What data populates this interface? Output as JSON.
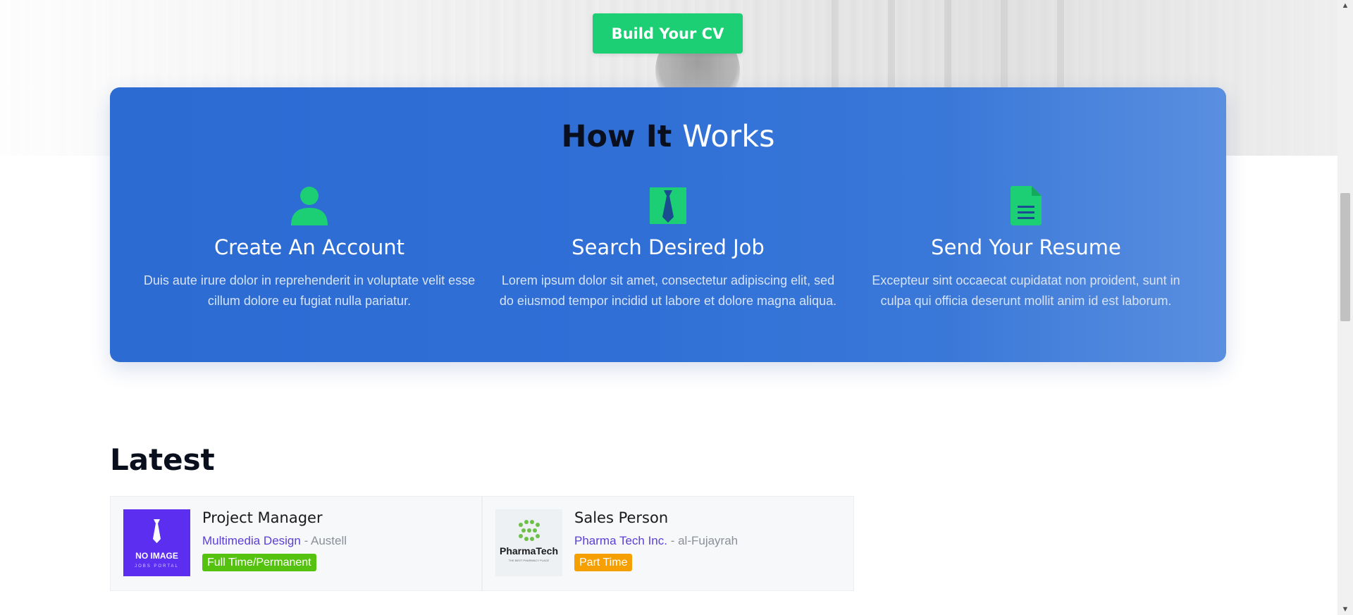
{
  "hero": {
    "cv_button_label": "Build Your CV"
  },
  "how_it_works": {
    "title_strong": "How It",
    "title_light": "Works",
    "steps": [
      {
        "icon": "user-icon",
        "title": "Create An Account",
        "text": "Duis aute irure dolor in reprehenderit in voluptate velit esse cillum dolore eu fugiat nulla pariatur."
      },
      {
        "icon": "tie-icon",
        "title": "Search Desired Job",
        "text": "Lorem ipsum dolor sit amet, consectetur adipiscing elit, sed do eiusmod tempor incidid ut labore et dolore magna aliqua."
      },
      {
        "icon": "document-icon",
        "title": "Send Your Resume",
        "text": "Excepteur sint occaecat cupidatat non proident, sunt in culpa qui officia deserunt mollit anim id est laborum."
      }
    ]
  },
  "latest": {
    "heading": "Latest",
    "jobs": [
      {
        "title": "Project Manager",
        "company": "Multimedia Design",
        "location": " - Austell",
        "type": "Full Time/Permanent",
        "type_color": "#55c20f",
        "logo_text": "NO IMAGE",
        "logo_subtext": "JOBS PORTAL",
        "logo_bg": "#5b2ef0"
      },
      {
        "title": "Sales Person",
        "company": "Pharma Tech Inc.",
        "location": " - al-Fujayrah",
        "type": "Part Time",
        "type_color": "#f5a000",
        "logo_text": "PharmaTech",
        "logo_subtext": "THE BEST PHARMACY PLACE",
        "logo_bg": "#eef1f4"
      }
    ]
  },
  "colors": {
    "accent_green": "#1ccf74",
    "card_blue": "#2f6fd6",
    "link_purple": "#5b3ed6"
  }
}
